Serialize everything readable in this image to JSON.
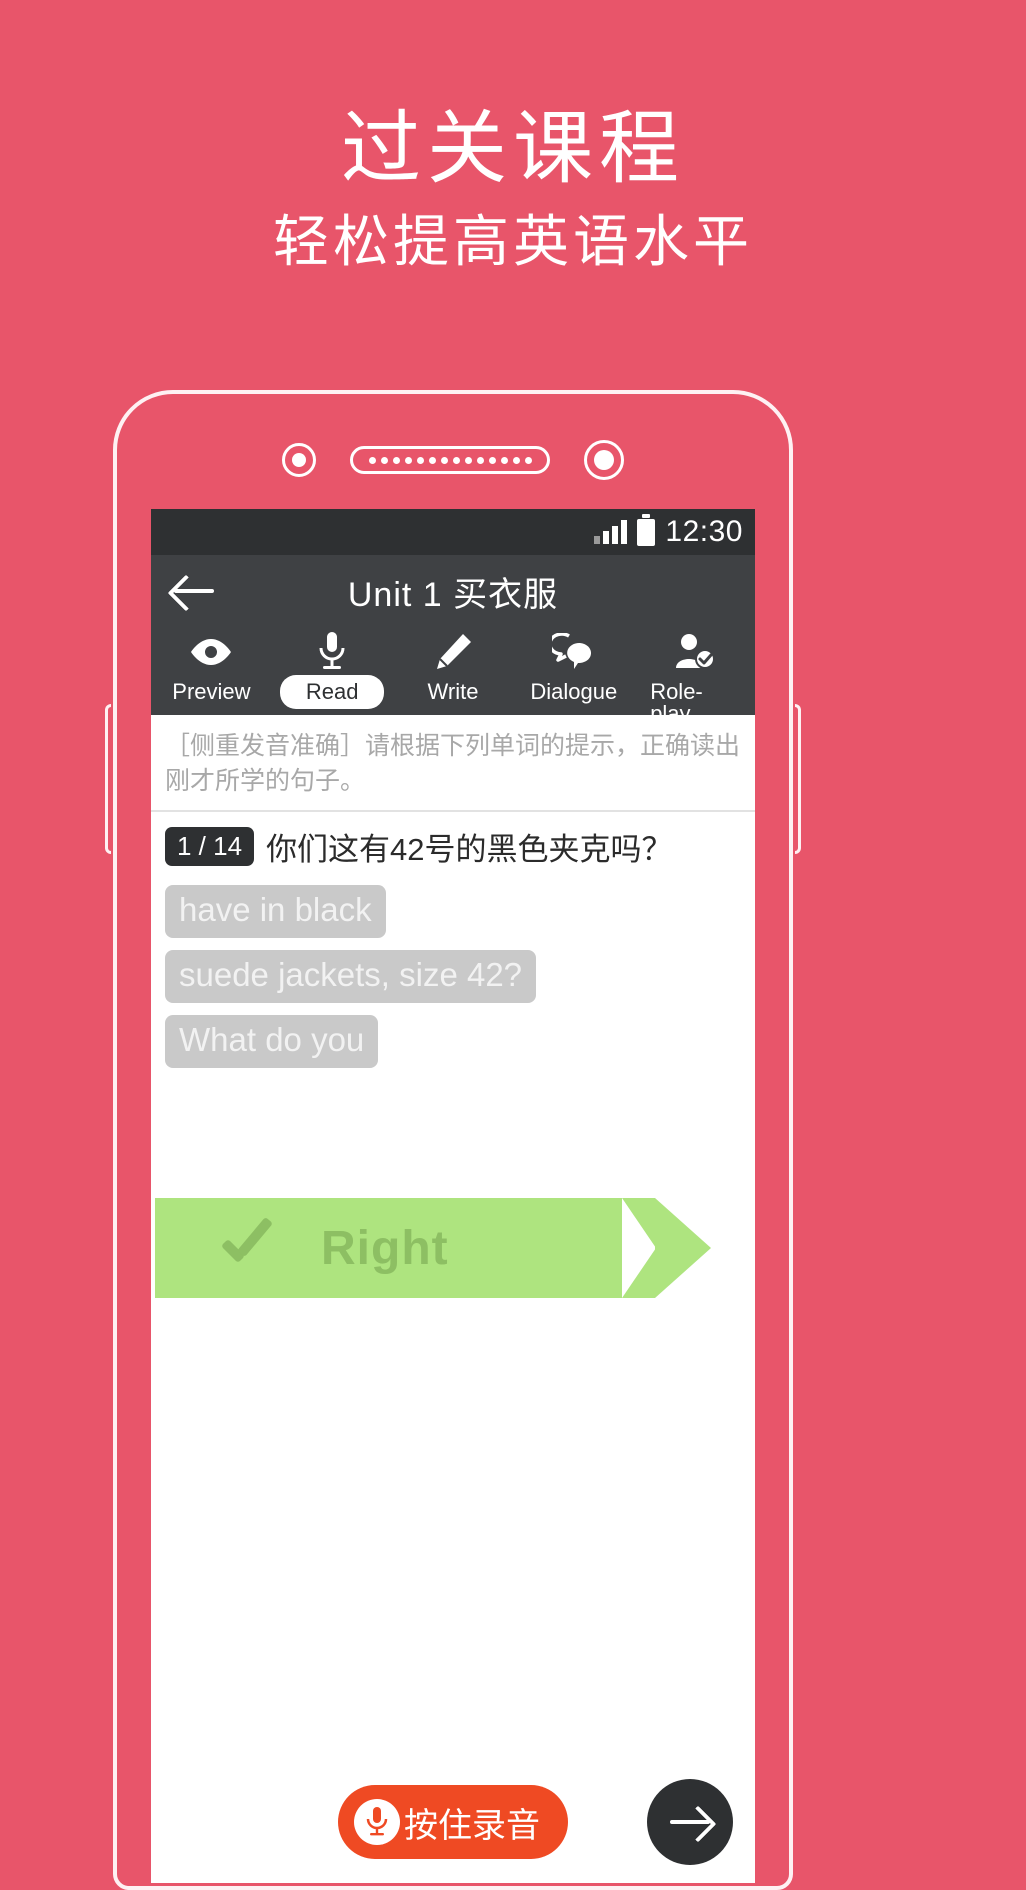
{
  "promo": {
    "title": "过关课程",
    "subtitle": "轻松提高英语水平"
  },
  "colors": {
    "background": "#e8556a",
    "statusbar": "#2e3032",
    "navbar": "#3f4144",
    "record_button": "#ef4a23",
    "banner": "#aee47f",
    "banner_text": "#8dbf63"
  },
  "phone": {
    "status_bar": {
      "clock": "12:30",
      "signal_icon": "signal-bars-icon",
      "battery_icon": "battery-icon"
    },
    "nav": {
      "back_icon": "back-arrow-icon",
      "title": "Unit 1 买衣服"
    },
    "tabs": [
      {
        "label": "Preview",
        "icon": "eye-icon",
        "active": false
      },
      {
        "label": "Read",
        "icon": "microphone-icon",
        "active": true
      },
      {
        "label": "Write",
        "icon": "pencil-icon",
        "active": false
      },
      {
        "label": "Dialogue",
        "icon": "speech-bubbles-icon",
        "active": false
      },
      {
        "label": "Role-play",
        "icon": "person-check-icon",
        "active": false
      }
    ],
    "instruction": "［侧重发音准确］请根据下列单词的提示，正确读出刚才所学的句子。",
    "question": {
      "badge": "1 / 14",
      "text": "你们这有42号的黑色夹克吗？"
    },
    "chips": [
      "have in black",
      "suede jackets, size 42?",
      "What do you"
    ],
    "result_banner": {
      "label": "Right",
      "icon": "check-icon"
    },
    "bottom": {
      "record_label": "按住录音",
      "record_icon": "microphone-icon",
      "next_icon": "arrow-right-icon"
    }
  }
}
